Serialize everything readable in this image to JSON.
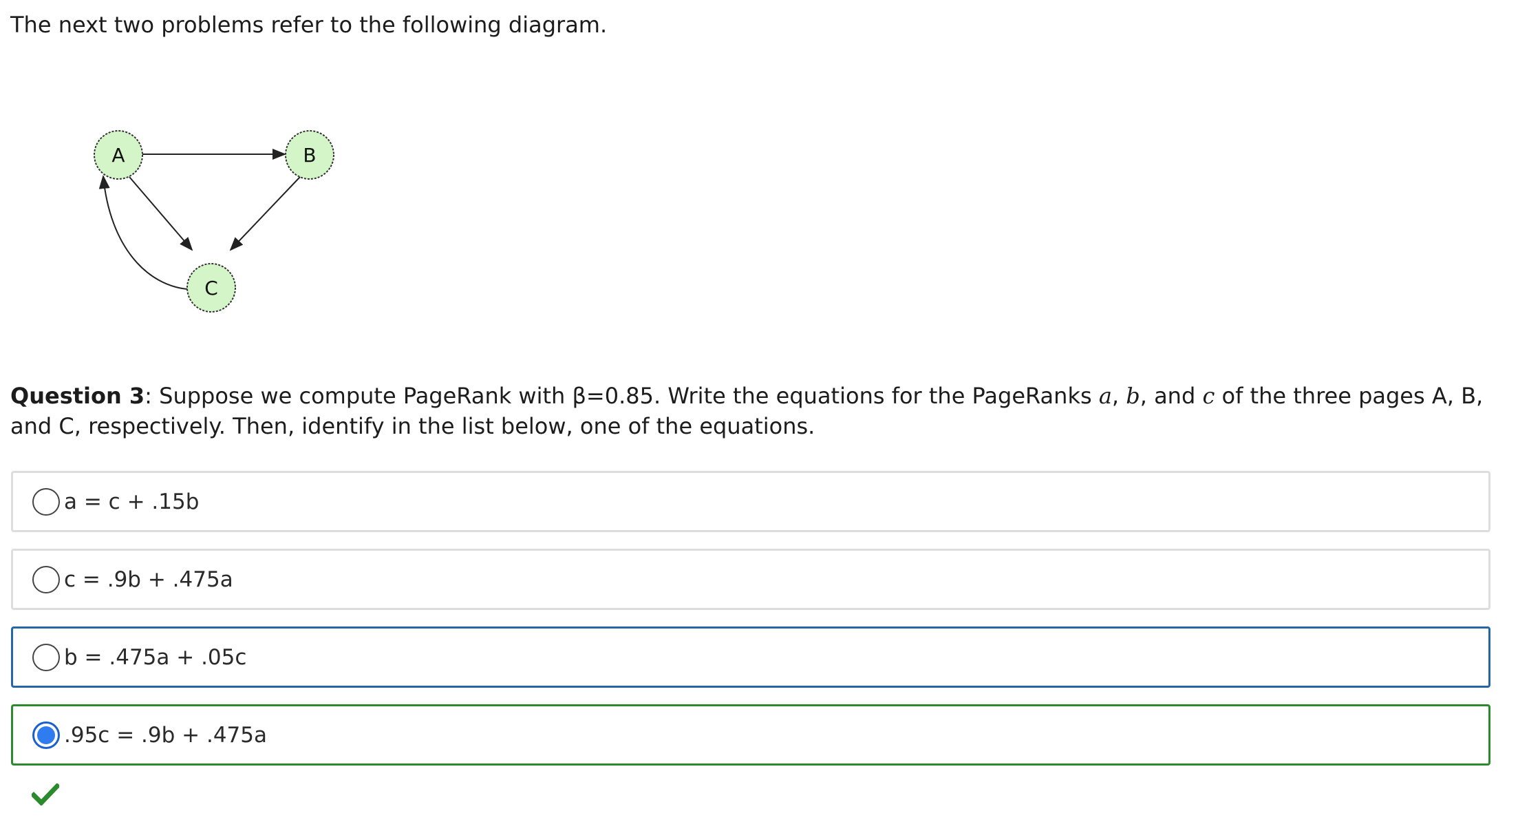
{
  "intro_text": "The next two problems refer to the following diagram.",
  "diagram": {
    "nodes": [
      {
        "id": "A",
        "label": "A"
      },
      {
        "id": "B",
        "label": "B"
      },
      {
        "id": "C",
        "label": "C"
      }
    ],
    "edges": [
      {
        "from": "A",
        "to": "B"
      },
      {
        "from": "A",
        "to": "C"
      },
      {
        "from": "B",
        "to": "C"
      },
      {
        "from": "C",
        "to": "A"
      }
    ],
    "node_fill": "#d4f5c8",
    "node_stroke": "#333333"
  },
  "question": {
    "title": "Question 3",
    "text_1": ": Suppose we compute PageRank with β=0.85. Write the equations for the PageRanks ",
    "var_a": "a",
    "sep_1": ", ",
    "var_b": "b",
    "sep_2": ", and ",
    "var_c": "c",
    "text_2": " of the three pages A, B, and C, respectively. Then, identify in the list below, one of the equations."
  },
  "options": [
    {
      "label": "a = c + .15b",
      "selected": false,
      "state": "default"
    },
    {
      "label": "c = .9b + .475a",
      "selected": false,
      "state": "default"
    },
    {
      "label": "b = .475a + .05c",
      "selected": false,
      "state": "focused"
    },
    {
      "label": ".95c = .9b + .475a",
      "selected": true,
      "state": "correct"
    }
  ],
  "feedback_icon": "checkmark-icon",
  "colors": {
    "focus_border": "#2566a8",
    "correct_border": "#2b8a2b",
    "default_border": "#dddddd",
    "radio_selected": "#2f7bf0",
    "checkmark": "#2b8a2b"
  }
}
